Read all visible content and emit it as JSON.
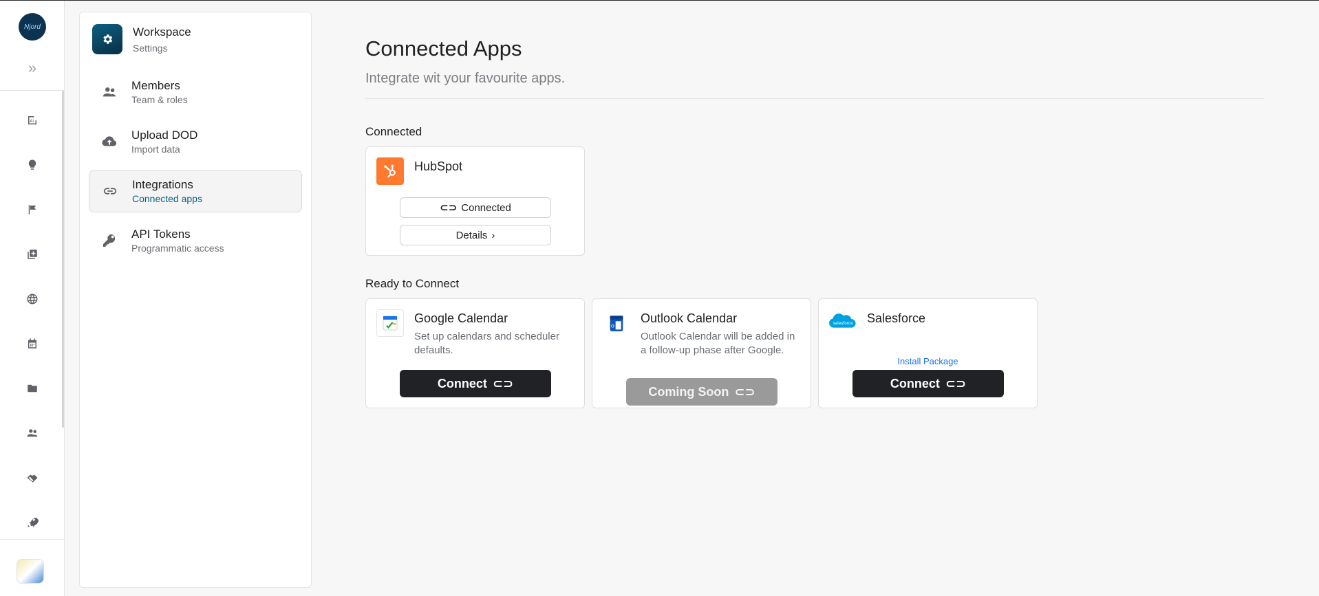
{
  "rail": {
    "logo_text": "Njord",
    "icons": [
      "ai-icon",
      "lightbulb-icon",
      "flag-icon",
      "add-copy-icon",
      "globe-icon",
      "calendar-icon",
      "folder-icon",
      "people-icon",
      "handshake-icon",
      "rocket-icon"
    ]
  },
  "panel": {
    "workspace": {
      "title": "Workspace",
      "subtitle": "Settings"
    },
    "items": [
      {
        "title": "Members",
        "subtitle": "Team & roles",
        "icon": "members-icon"
      },
      {
        "title": "Upload DOD",
        "subtitle": "Import data",
        "icon": "cloud-upload-icon"
      },
      {
        "title": "Integrations",
        "subtitle": "Connected apps",
        "icon": "link-icon",
        "active": true
      },
      {
        "title": "API Tokens",
        "subtitle": "Programmatic access",
        "icon": "key-icon"
      }
    ]
  },
  "main": {
    "title": "Connected Apps",
    "subtitle": "Integrate wit your favourite apps.",
    "connected_heading": "Connected",
    "ready_heading": "Ready to Connect",
    "hubspot": {
      "name": "HubSpot",
      "status_label": "Connected",
      "details_label": "Details"
    },
    "google": {
      "name": "Google Calendar",
      "desc": "Set up calendars and scheduler defaults.",
      "button": "Connect"
    },
    "outlook": {
      "name": "Outlook Calendar",
      "desc": "Outlook Calendar will be added in a follow-up phase after Google.",
      "button": "Coming Soon"
    },
    "salesforce": {
      "name": "Salesforce",
      "logo_text": "salesforce",
      "install_link": "Install Package",
      "button": "Connect"
    }
  },
  "colors": {
    "hubspot": "#ff7a2f",
    "dark_button": "#202226",
    "disabled_button": "#9a9a9a",
    "link": "#1a73e8",
    "active_sub": "#0b5f86"
  }
}
